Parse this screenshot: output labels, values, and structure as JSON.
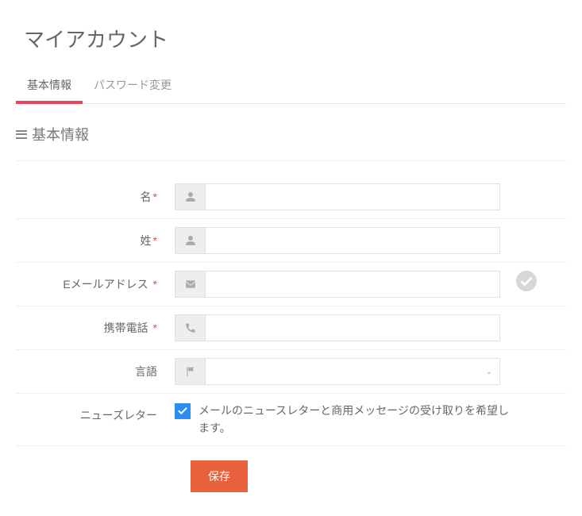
{
  "page": {
    "title": "マイアカウント"
  },
  "tabs": [
    {
      "label": "基本情報",
      "active": true
    },
    {
      "label": "パスワード変更",
      "active": false
    }
  ],
  "section": {
    "title": "基本情報"
  },
  "form": {
    "first_name": {
      "label": "名",
      "required": true,
      "value": ""
    },
    "last_name": {
      "label": "姓",
      "required": true,
      "value": ""
    },
    "email": {
      "label": "Eメールアドレス",
      "required": true,
      "value": ""
    },
    "mobile": {
      "label": "携帯電話",
      "required": true,
      "value": ""
    },
    "language": {
      "label": "言語",
      "required": false,
      "value": ""
    },
    "newsletter": {
      "label": "ニューズレター",
      "checkbox_label": "メールのニュースレターと商用メッセージの受け取りを希望します。",
      "checked": true
    }
  },
  "buttons": {
    "save": "保存"
  },
  "icons": {
    "user": "user-icon",
    "envelope": "envelope-icon",
    "phone": "phone-icon",
    "flag": "flag-icon",
    "check_circle": "check-circle-icon"
  },
  "colors": {
    "accent": "#e8425c",
    "primary_button": "#e8603c",
    "checkbox": "#2d8cf0"
  }
}
